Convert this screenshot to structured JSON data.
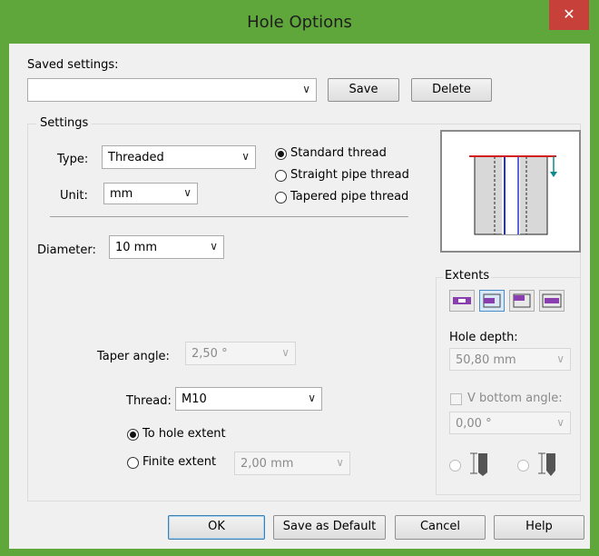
{
  "window": {
    "title": "Hole Options",
    "close_glyph": "✕"
  },
  "saved": {
    "label": "Saved settings:",
    "value": "",
    "save": "Save",
    "delete": "Delete"
  },
  "settings": {
    "group_label": "Settings",
    "type_label": "Type:",
    "type_value": "Threaded",
    "unit_label": "Unit:",
    "unit_value": "mm",
    "thread_kinds": [
      {
        "label": "Standard thread",
        "selected": true
      },
      {
        "label": "Straight pipe thread",
        "selected": false
      },
      {
        "label": "Tapered pipe thread",
        "selected": false
      }
    ],
    "diameter_label": "Diameter:",
    "diameter_value": "10 mm",
    "taper_label": "Taper angle:",
    "taper_value": "2,50 °",
    "thread_label": "Thread:",
    "thread_value": "M10",
    "to_hole_extent": "To hole extent",
    "finite_extent": "Finite extent",
    "finite_value": "2,00 mm"
  },
  "extents": {
    "label": "Extents",
    "hole_depth_label": "Hole depth:",
    "hole_depth_value": "50,80 mm",
    "v_bottom_label": "V bottom angle:",
    "v_bottom_value": "0,00 °"
  },
  "footer": {
    "ok": "OK",
    "save_default": "Save as Default",
    "cancel": "Cancel",
    "help": "Help"
  },
  "colors": {
    "accent": "#5fa63b",
    "close": "#c7403a",
    "preview_red": "#d02020",
    "preview_blue": "#2233cc",
    "preview_teal": "#0a8a8a"
  }
}
